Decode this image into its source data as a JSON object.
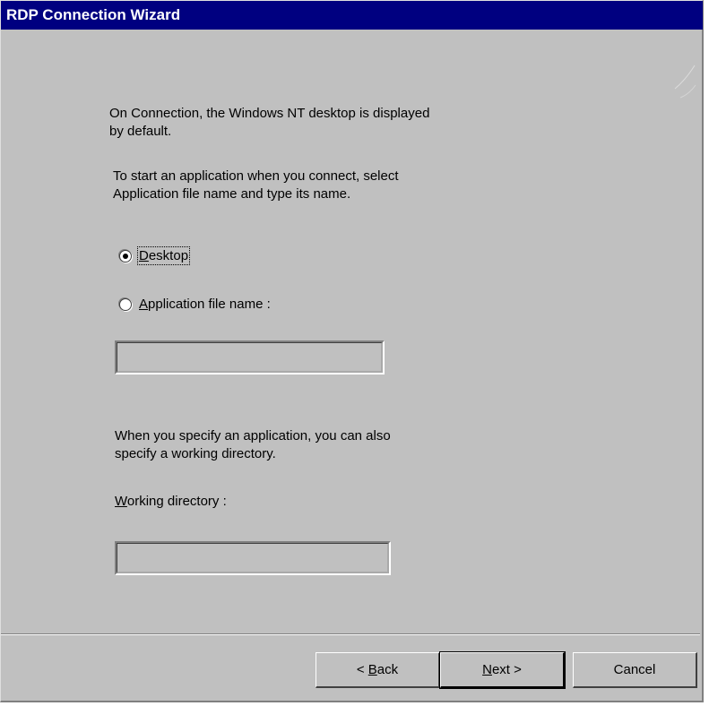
{
  "window": {
    "title": "RDP Connection Wizard"
  },
  "intro": {
    "line1": "On Connection, the Windows NT desktop is displayed",
    "line2": "by default.",
    "line3": "To start an application when you connect, select",
    "line4": "Application file name and type its name."
  },
  "options": {
    "desktop": {
      "mnemonic": "D",
      "rest": "esktop",
      "checked": true
    },
    "application": {
      "mnemonic": "A",
      "rest": "pplication file name :",
      "checked": false
    }
  },
  "app_field": {
    "value": ""
  },
  "workdir_note": {
    "line1": "When you specify an application, you can also",
    "line2": "specify a working directory."
  },
  "workdir_label": {
    "mnemonic": "W",
    "rest": "orking directory :"
  },
  "workdir_field": {
    "value": ""
  },
  "buttons": {
    "back": {
      "prefix": "< ",
      "mnemonic": "B",
      "rest": "ack"
    },
    "next": {
      "mnemonic": "N",
      "rest": "ext >"
    },
    "cancel": "Cancel"
  }
}
